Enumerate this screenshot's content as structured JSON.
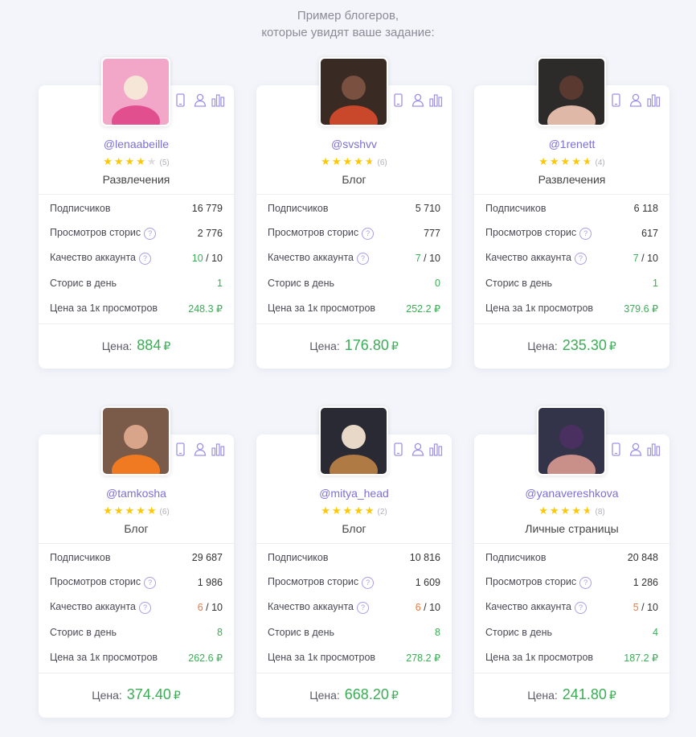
{
  "heading": {
    "line1": "Пример блогеров,",
    "line2": "которые увидят ваше задание:"
  },
  "labels": {
    "subscribers": "Подписчиков",
    "story_views": "Просмотров сторис",
    "account_quality": "Качество аккаунта",
    "stories_per_day": "Сторис в день",
    "price_per_1k": "Цена за 1к просмотров",
    "price": "Цена:",
    "question_mark": "?",
    "quality_max": "/ 10",
    "currency": "₽",
    "star": "★"
  },
  "colors": {
    "accent": "#7d6fd8",
    "green": "#3aad55",
    "orange": "#f07a3e",
    "star": "#ffc800",
    "star_off": "#dcdce2"
  },
  "icons": [
    "phone-icon",
    "user-icon",
    "bar-chart-icon"
  ],
  "bloggers": [
    {
      "handle": "@lenaabeille",
      "rating": 4,
      "reviews": "(5)",
      "category": "Развлечения",
      "subscribers": "16 779",
      "story_views": "2 776",
      "quality": "10",
      "quality_color": "green",
      "stories_per_day": "1",
      "price_per_1k": "248.3 ₽",
      "price": "884"
    },
    {
      "handle": "@svshvv",
      "rating": 4.5,
      "reviews": "(6)",
      "category": "Блог",
      "subscribers": "5 710",
      "story_views": "777",
      "quality": "7",
      "quality_color": "green",
      "stories_per_day": "0",
      "price_per_1k": "252.2 ₽",
      "price": "176.80"
    },
    {
      "handle": "@1renett",
      "rating": 4.5,
      "reviews": "(4)",
      "category": "Развлечения",
      "subscribers": "6 118",
      "story_views": "617",
      "quality": "7",
      "quality_color": "green",
      "stories_per_day": "1",
      "price_per_1k": "379.6 ₽",
      "price": "235.30"
    },
    {
      "handle": "@tamkosha",
      "rating": 5,
      "reviews": "(6)",
      "category": "Блог",
      "subscribers": "29 687",
      "story_views": "1 986",
      "quality": "6",
      "quality_color": "orange",
      "stories_per_day": "8",
      "price_per_1k": "262.6 ₽",
      "price": "374.40"
    },
    {
      "handle": "@mitya_head",
      "rating": 5,
      "reviews": "(2)",
      "category": "Блог",
      "subscribers": "10 816",
      "story_views": "1 609",
      "quality": "6",
      "quality_color": "orange",
      "stories_per_day": "8",
      "price_per_1k": "278.2 ₽",
      "price": "668.20"
    },
    {
      "handle": "@yanavereshkova",
      "rating": 4.5,
      "reviews": "(8)",
      "category": "Личные страницы",
      "subscribers": "20 848",
      "story_views": "1 286",
      "quality": "5",
      "quality_color": "orange",
      "stories_per_day": "4",
      "price_per_1k": "187.2 ₽",
      "price": "241.80"
    }
  ]
}
